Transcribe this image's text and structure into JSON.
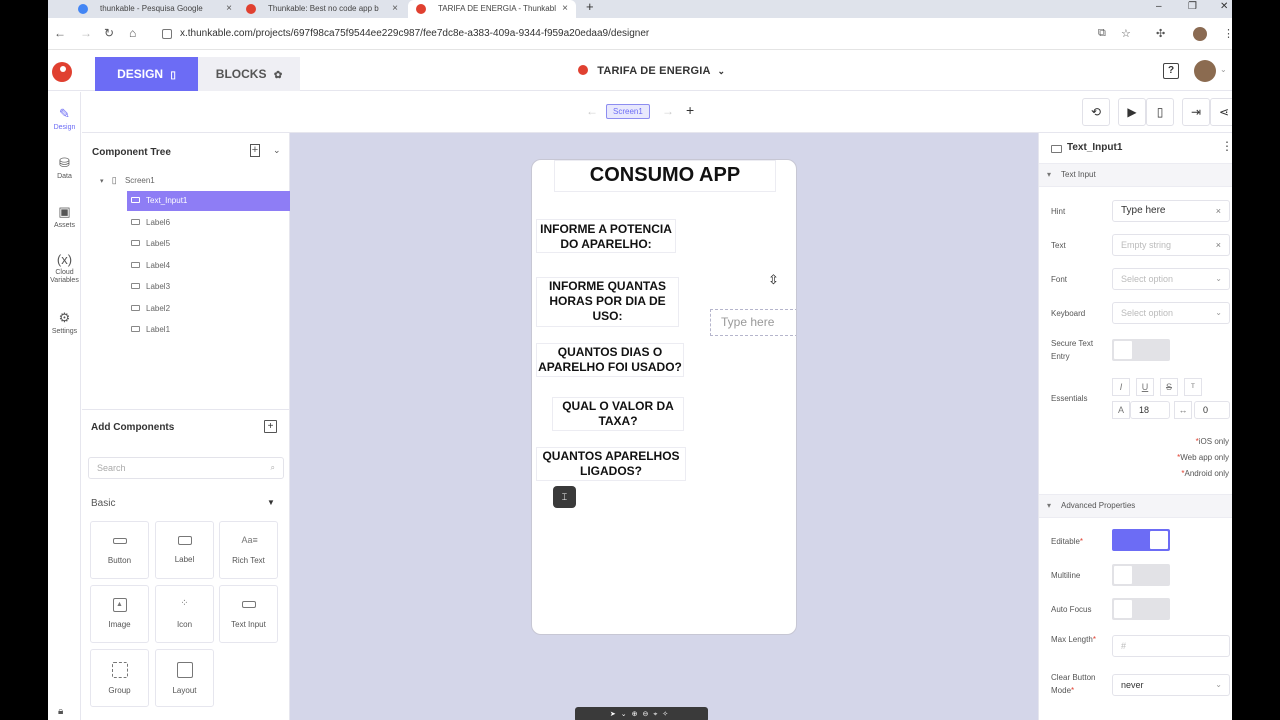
{
  "browser": {
    "tabs": [
      {
        "title": "thunkable - Pesquisa Google",
        "active": false
      },
      {
        "title": "Thunkable: Best no code app b",
        "active": false
      },
      {
        "title": "TARIFA DE ENERGIA - Thunkabl",
        "active": true
      }
    ],
    "new_tab": "+",
    "url": "x.thunkable.com/projects/697f98ca75f9544ee229c987/fee7dc8e-a383-409a-9344-f959a20edaa9/designer"
  },
  "header": {
    "design_tab": "DESIGN",
    "blocks_tab": "BLOCKS",
    "project_title": "TARIFA DE ENERGIA",
    "help_icon": "?"
  },
  "left_nav": [
    {
      "label": "Design",
      "icon": "✎"
    },
    {
      "label": "Data",
      "icon": "⛁"
    },
    {
      "label": "Assets",
      "icon": "▣"
    },
    {
      "label": "Cloud Variables",
      "icon": "(x)"
    },
    {
      "label": "Settings",
      "icon": "⚙"
    }
  ],
  "toolbar": {
    "screen_name": "Screen1",
    "add": "+"
  },
  "component_tree": {
    "title": "Component Tree",
    "root": "Screen1",
    "items": [
      "Text_Input1",
      "Label6",
      "Label5",
      "Label4",
      "Label3",
      "Label2",
      "Label1"
    ],
    "selected": "Text_Input1"
  },
  "add_components": {
    "title": "Add Components",
    "search_placeholder": "Search",
    "category": "Basic",
    "items": [
      "Button",
      "Label",
      "Rich Text",
      "Image",
      "Icon",
      "Text Input",
      "Group",
      "Layout"
    ]
  },
  "phone": {
    "title": "CONSUMO APP",
    "labels": [
      "INFORME A POTENCIA DO APARELHO:",
      "INFORME QUANTAS HORAS POR DIA DE USO:",
      "QUANTOS DIAS O APARELHO FOI USADO?",
      "QUAL O VALOR DA TAXA?",
      "QUANTOS APARELHOS LIGADOS?"
    ],
    "text_input_placeholder": "Type here"
  },
  "properties": {
    "component_name": "Text_Input1",
    "section1": "Text Input",
    "hint_label": "Hint",
    "hint_value": "Type here",
    "text_label": "Text",
    "text_placeholder": "Empty string",
    "font_label": "Font",
    "font_placeholder": "Select option",
    "keyboard_label": "Keyboard",
    "keyboard_placeholder": "Select option",
    "secure_label": "Secure Text Entry",
    "essentials_label": "Essentials",
    "font_size": "18",
    "letter_spacing": "0",
    "note_ios": "iOS only",
    "note_web": "Web app only",
    "note_android": "Android only",
    "section2": "Advanced Properties",
    "editable_label": "Editable",
    "editable_on": true,
    "multiline_label": "Multiline",
    "autofocus_label": "Auto Focus",
    "maxlength_label": "Max Length",
    "maxlength_placeholder": "#",
    "clearbutton_label": "Clear Button Mode",
    "clearbutton_value": "never"
  }
}
